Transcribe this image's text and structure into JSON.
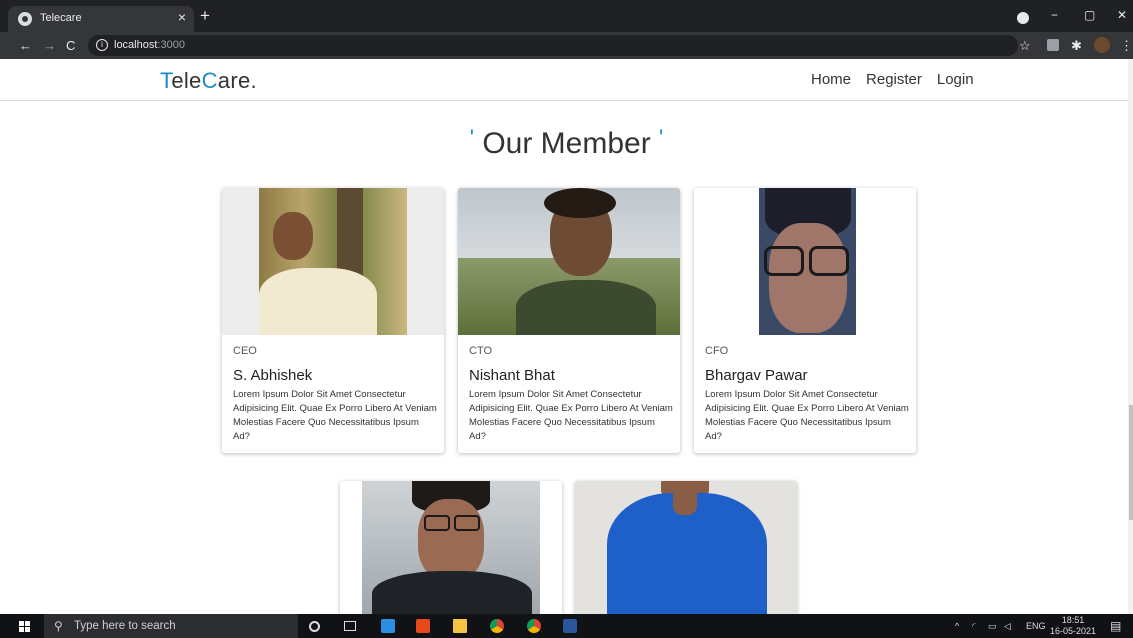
{
  "browser": {
    "tab_title": "Telecare",
    "tab_close": "×",
    "new_tab": "+",
    "url_host": "localhost",
    "url_port": ":3000",
    "window": {
      "minimize": "−",
      "maximize": "▢",
      "close": "✕"
    }
  },
  "site": {
    "logo_parts": [
      "T",
      "ele",
      "C",
      "are."
    ],
    "nav": [
      "Home",
      "Register",
      "Login"
    ]
  },
  "section": {
    "quote_open": "'",
    "title": "Our Member",
    "quote_close": "'"
  },
  "members": [
    {
      "role": "CEO",
      "name": "S. Abhishek",
      "desc": "Lorem Ipsum Dolor Sit Amet Consectetur Adipisicing Elit. Quae Ex Porro Libero At Veniam Molestias Facere Quo Necessitatibus Ipsum Ad?"
    },
    {
      "role": "CTO",
      "name": "Nishant Bhat",
      "desc": "Lorem Ipsum Dolor Sit Amet Consectetur Adipisicing Elit. Quae Ex Porro Libero At Veniam Molestias Facere Quo Necessitatibus Ipsum Ad?"
    },
    {
      "role": "CFO",
      "name": "Bhargav Pawar",
      "desc": "Lorem Ipsum Dolor Sit Amet Consectetur Adipisicing Elit. Quae Ex Porro Libero At Veniam Molestias Facere Quo Necessitatibus Ipsum Ad?"
    }
  ],
  "taskbar": {
    "search_placeholder": "Type here to search",
    "lang": "ENG",
    "time": "18:51",
    "date": "16-05-2021"
  },
  "colors": {
    "accent": "#1a8cc7"
  }
}
